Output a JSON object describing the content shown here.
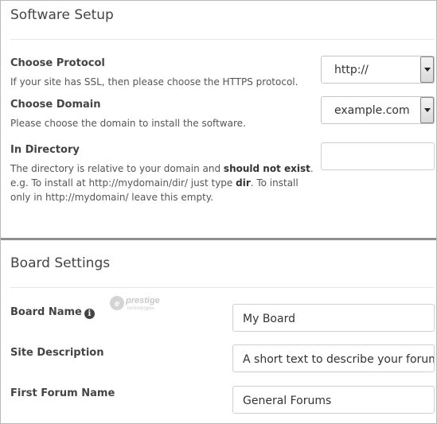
{
  "software_setup": {
    "title": "Software Setup",
    "protocol": {
      "label": "Choose Protocol",
      "help": "If your site has SSL, then please choose the HTTPS protocol.",
      "value": "http://"
    },
    "domain": {
      "label": "Choose Domain",
      "help": "Please choose the domain to install the software.",
      "value": "example.com"
    },
    "directory": {
      "label": "In Directory",
      "help_part1": "The directory is relative to your domain and ",
      "help_bold1": "should not exist",
      "help_part2": ". e.g. To install at http://mydomain/dir/ just type ",
      "help_bold2": "dir",
      "help_part3": ". To install only in http://mydomain/ leave this empty.",
      "value": ""
    }
  },
  "board_settings": {
    "title": "Board Settings",
    "board_name": {
      "label": "Board Name",
      "value": "My Board",
      "info_icon": "info-icon"
    },
    "site_description": {
      "label": "Site Description",
      "value": "A short text to describe your forum"
    },
    "first_forum_name": {
      "label": "First Forum Name",
      "value": "General Forums"
    }
  },
  "watermark": {
    "name": "prestige",
    "sub": "technologies"
  }
}
